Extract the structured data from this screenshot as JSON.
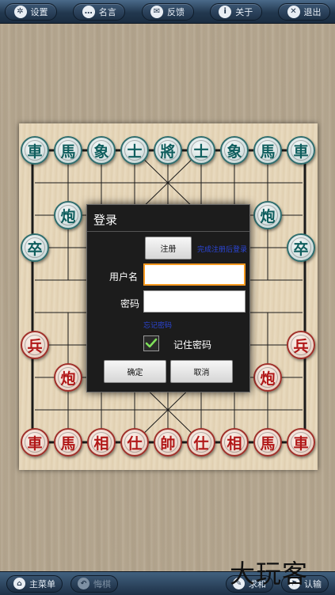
{
  "topbar": {
    "buttons": [
      {
        "label": "设置",
        "icon": "gear-icon"
      },
      {
        "label": "名言",
        "icon": "speech-bubble-icon"
      },
      {
        "label": "反馈",
        "icon": "mail-icon"
      },
      {
        "label": "关于",
        "icon": "info-icon"
      },
      {
        "label": "退出",
        "icon": "close-icon"
      }
    ]
  },
  "board": {
    "black_top_row": [
      "車",
      "馬",
      "象",
      "士",
      "將",
      "士",
      "象",
      "馬",
      "車"
    ],
    "black_cannon": "炮",
    "black_soldier": "卒",
    "red_soldier": "兵",
    "red_cannon": "炮",
    "red_bottom_row": [
      "車",
      "馬",
      "相",
      "仕",
      "帥",
      "仕",
      "相",
      "馬",
      "車"
    ]
  },
  "dialog": {
    "title": "登录",
    "register_label": "注册",
    "register_hint": "完成注册后登录",
    "username_label": "用户名",
    "username_value": "",
    "password_label": "密码",
    "password_value": "",
    "forgot_label": "忘记密码",
    "remember_label": "记住密码",
    "remember_checked": true,
    "ok_label": "确定",
    "cancel_label": "取消"
  },
  "bottombar": {
    "buttons": [
      {
        "label": "主菜单",
        "icon": "home-icon"
      },
      {
        "label": "悔棋",
        "icon": "undo-icon"
      },
      {
        "label": "求和",
        "icon": "pencil-icon"
      },
      {
        "label": "认输",
        "icon": "flag-icon"
      }
    ]
  },
  "watermark": "大玩客",
  "colors": {
    "bar": "#22384f",
    "red_piece": "#b11818",
    "black_piece": "#0f5e5e",
    "focus": "#ff9a1f"
  }
}
